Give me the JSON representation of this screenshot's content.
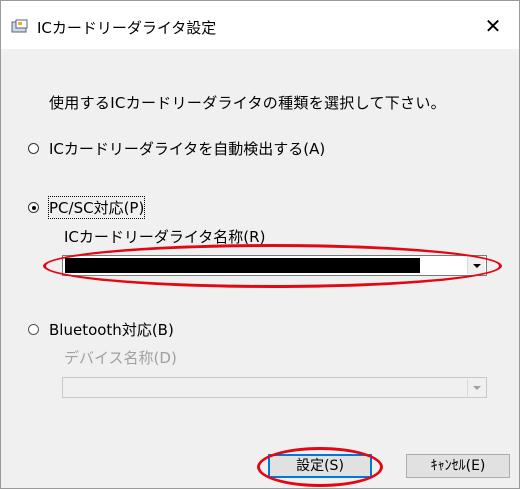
{
  "window": {
    "title": "ICカードリーダライタ設定",
    "app_icon": "card-reader-icon",
    "close_glyph": "✕"
  },
  "instruction": "使用するICカードリーダライタの種類を選択して下さい。",
  "options": {
    "auto_detect": {
      "label": "ICカードリーダライタを自動検出する(A)",
      "selected": false
    },
    "pcsc": {
      "label": "PC/SC対応(P)",
      "selected": true,
      "reader_name_label": "ICカードリーダライタ名称(R)",
      "reader_name_value": "[redacted]"
    },
    "bluetooth": {
      "label": "Bluetooth対応(B)",
      "selected": false,
      "device_name_label": "デバイス名称(D)",
      "device_name_value": ""
    }
  },
  "buttons": {
    "ok": "設定(S)",
    "cancel": "ｷｬﾝｾﾙ(E)"
  },
  "colors": {
    "highlight": "#e30613",
    "disabled_text": "#a0a0a0",
    "dialog_bg": "#f0f0f0"
  }
}
